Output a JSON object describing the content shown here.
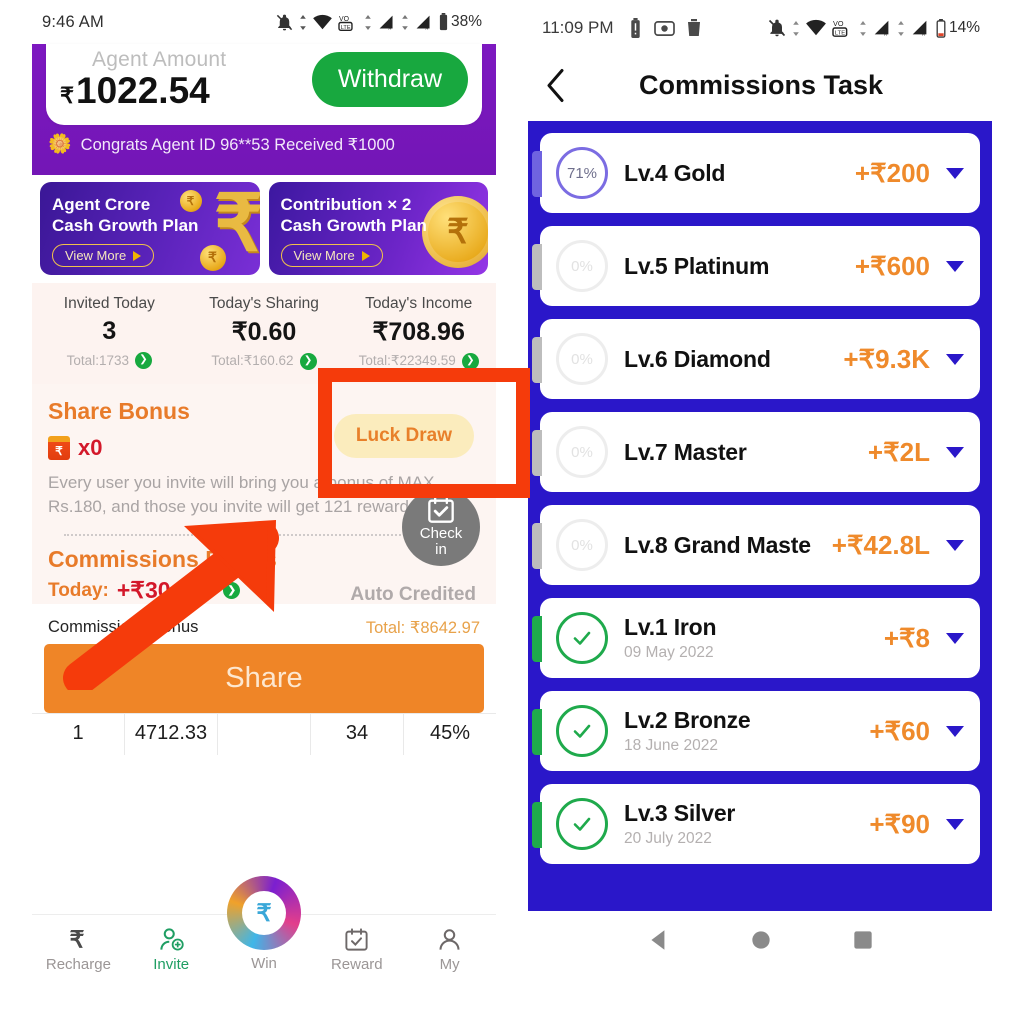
{
  "left_phone": {
    "status_bar": {
      "time": "9:46 AM",
      "battery": "38%"
    },
    "header": {
      "amount_label": "Agent Amount",
      "currency": "₹",
      "amount_value": "1022.54",
      "withdraw_label": "Withdraw",
      "congrats_text": "Congrats Agent ID 96**53 Received ₹1000"
    },
    "promos": [
      {
        "line1": "Agent Crore",
        "line2": "Cash Growth Plan",
        "cta": "View More"
      },
      {
        "line1": "Contribution × 2",
        "line2": "Cash Growth Plan",
        "cta": "View More"
      }
    ],
    "stats": [
      {
        "label": "Invited Today",
        "value": "3",
        "total": "Total:1733"
      },
      {
        "label": "Today's Sharing",
        "value": "₹0.60",
        "total": "Total:₹160.62"
      },
      {
        "label": "Today's Income",
        "value": "₹708.96",
        "total": "Total:₹22349.59",
        "highlighted": true
      }
    ],
    "share_bonus": {
      "title": "Share Bonus",
      "count": "x0",
      "description": "Every user you invite will bring you a bonus of MAX Rs.180, and those you invite will get 121 rewards",
      "luck_draw_label": "Luck Draw"
    },
    "commissions_bonus": {
      "title": "Commissions Bonus",
      "today_key": "Today:",
      "today_value": "+₹304.36",
      "auto_credited": "Auto Credited",
      "check_in_line1": "Check",
      "check_in_line2": "in"
    },
    "table": {
      "header_left": "Commissions Bonus",
      "header_right": "Total: ₹8642.97",
      "row": [
        "1",
        "4712.33",
        "",
        "34",
        "45%"
      ]
    },
    "share_button": "Share",
    "bottom_nav": [
      {
        "label": "Recharge",
        "icon": "rupee-icon"
      },
      {
        "label": "Invite",
        "icon": "person-add-icon"
      },
      {
        "label": "Win",
        "icon": "money-bag-icon"
      },
      {
        "label": "Reward",
        "icon": "calendar-check-icon"
      },
      {
        "label": "My",
        "icon": "person-icon"
      }
    ]
  },
  "right_phone": {
    "status_bar": {
      "time": "11:09 PM",
      "battery": "14%"
    },
    "title": "Commissions Task",
    "levels": [
      {
        "name": "Lv.4 Gold",
        "date": "",
        "amount": "+₹200",
        "progress": "71%",
        "state": "progress"
      },
      {
        "name": "Lv.5 Platinum",
        "date": "",
        "amount": "+₹600",
        "progress": "0%",
        "state": "locked"
      },
      {
        "name": "Lv.6 Diamond",
        "date": "",
        "amount": "+₹9.3K",
        "progress": "0%",
        "state": "locked"
      },
      {
        "name": "Lv.7 Master",
        "date": "",
        "amount": "+₹2L",
        "progress": "0%",
        "state": "locked"
      },
      {
        "name": "Lv.8 Grand Maste",
        "date": "",
        "amount": "+₹42.8L",
        "progress": "0%",
        "state": "locked"
      },
      {
        "name": "Lv.1 Iron",
        "date": "09 May 2022",
        "amount": "+₹8",
        "progress": "",
        "state": "done"
      },
      {
        "name": "Lv.2 Bronze",
        "date": "18 June 2022",
        "amount": "+₹60",
        "progress": "",
        "state": "done"
      },
      {
        "name": "Lv.3 Silver",
        "date": "20 July 2022",
        "amount": "+₹90",
        "progress": "",
        "state": "done"
      }
    ]
  },
  "colors": {
    "purple_header": "#7a19be",
    "blue_panel": "#2a17c9",
    "orange_accent": "#ef8a2b",
    "green": "#18a83f",
    "red_annotation": "#f53b0b",
    "crimson": "#d3182a"
  }
}
